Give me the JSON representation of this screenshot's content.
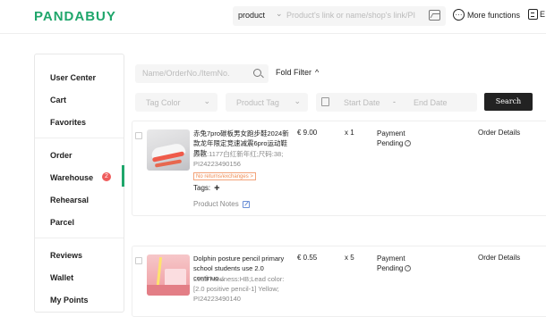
{
  "header": {
    "logo": "PANDABUY",
    "search_type": "product",
    "search_placeholder": "Product's link or name/shop's link/PI",
    "more_functions": "More functions",
    "lang": "E"
  },
  "sidebar": {
    "items": [
      {
        "label": "User Center"
      },
      {
        "label": "Cart"
      },
      {
        "label": "Favorites"
      },
      {
        "label": "Order"
      },
      {
        "label": "Warehouse",
        "badge": "2"
      },
      {
        "label": "Rehearsal"
      },
      {
        "label": "Parcel"
      },
      {
        "label": "Reviews"
      },
      {
        "label": "Wallet"
      },
      {
        "label": "My Points"
      }
    ]
  },
  "filters": {
    "search_placeholder": "Name/OrderNo./ItemNo.",
    "fold_filter": "Fold Filter",
    "tag_color": "Tag Color",
    "product_tag": "Product Tag",
    "start_date": "Start Date",
    "end_date": "End Date",
    "date_sep": "-",
    "search_button": "Search"
  },
  "orders": [
    {
      "title": "赤兔7pro碳板男女跑步鞋2024新款龙年限定竞速减震6pro运动鞋男款",
      "attr": "颜色:1177白红新年红;尺码:38;",
      "pi": "PI24223490156",
      "price": "€ 9.00",
      "qty": "x 1",
      "status": "Payment",
      "status_sub": "Pending",
      "details": "Order Details",
      "no_return": "No returns/exchanges >",
      "tags_label": "Tags:",
      "notes_label": "Product Notes"
    },
    {
      "title": "Dolphin posture pencil primary school students use 2.0 continuo...",
      "attr": "Lead hardness:HB;Lead color:[2.0 positive pencil-1] Yellow;",
      "pi": "PI24223490140",
      "price": "€ 0.55",
      "qty": "x 5",
      "status": "Payment",
      "status_sub": "Pending",
      "details": "Order Details"
    }
  ],
  "colors": {
    "brand": "#1fa66b",
    "badge": "#ef5b5b",
    "warning": "#f08a50"
  }
}
